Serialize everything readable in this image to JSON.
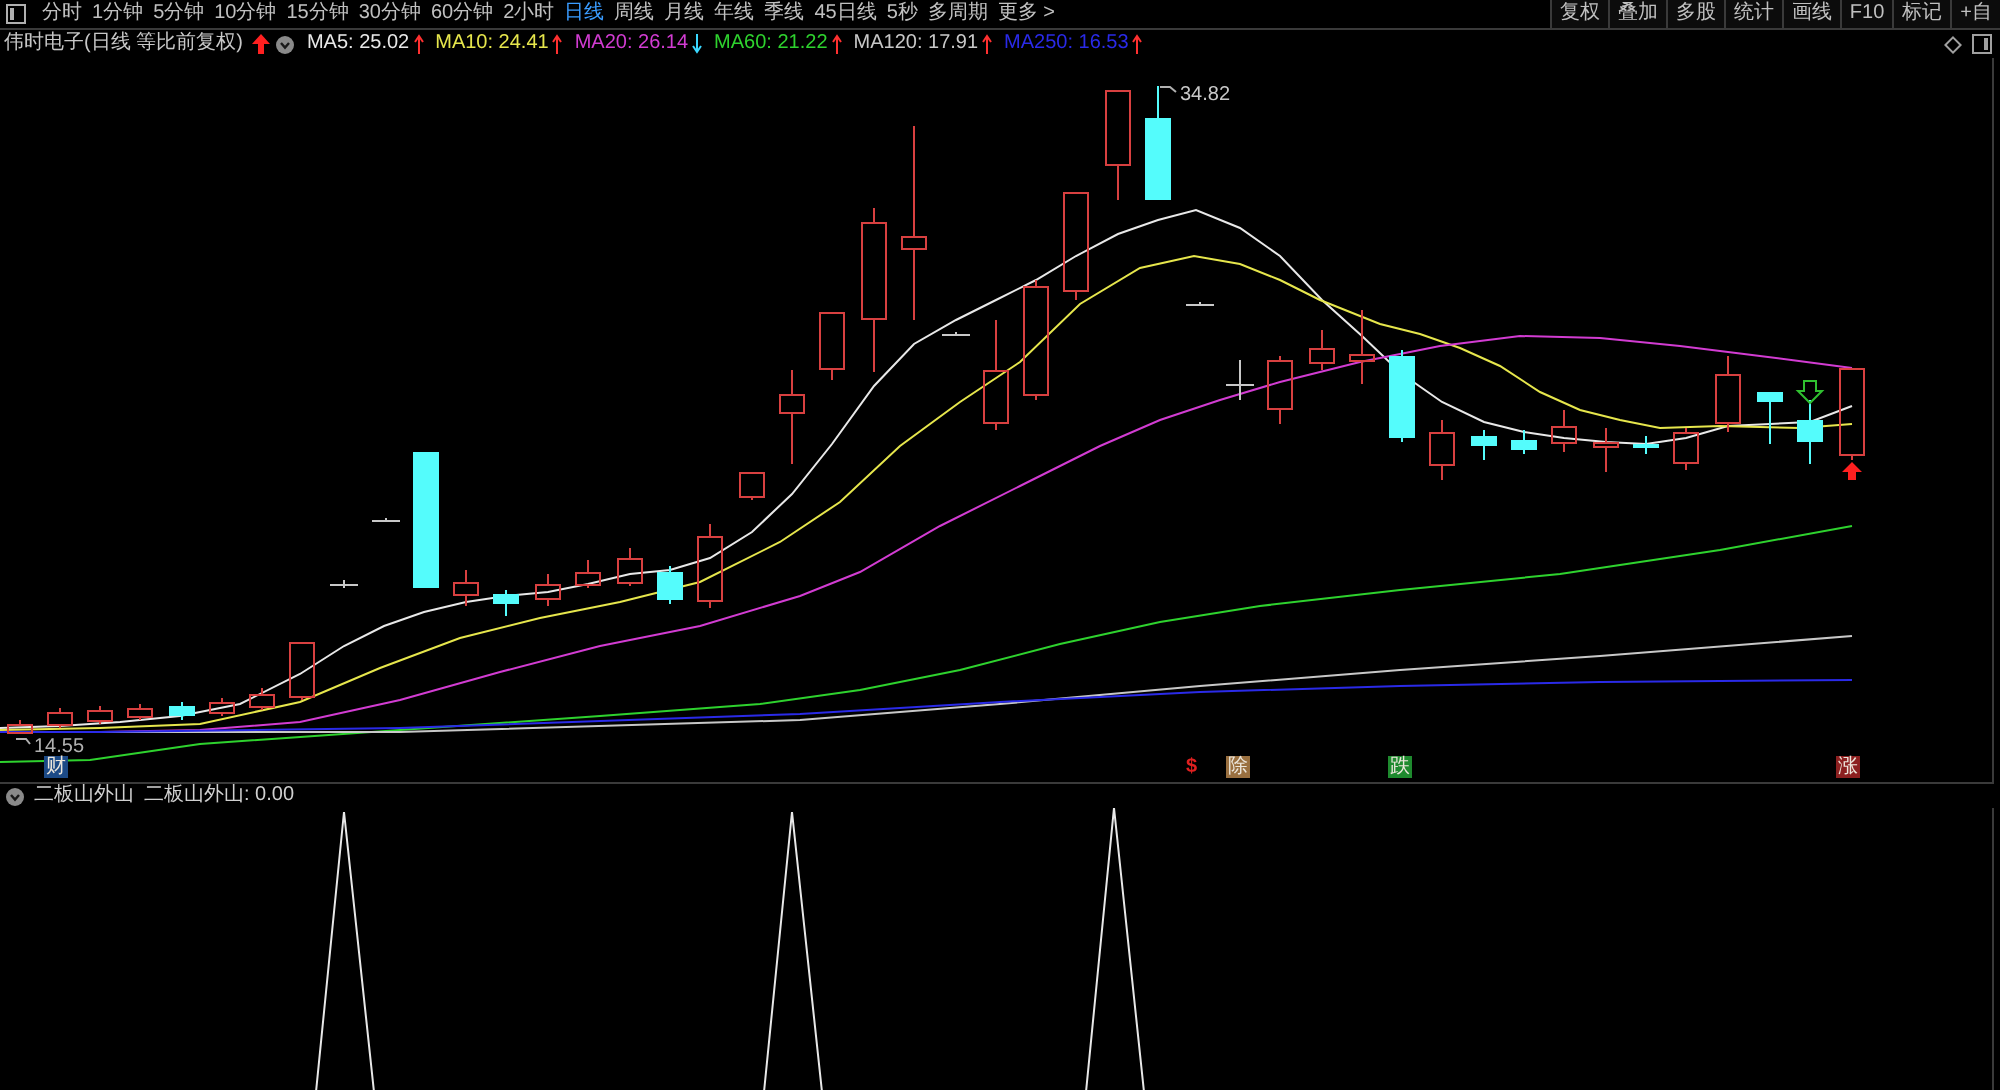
{
  "toolbar": {
    "periods": [
      {
        "label": "分时",
        "selected": false
      },
      {
        "label": "1分钟",
        "selected": false
      },
      {
        "label": "5分钟",
        "selected": false
      },
      {
        "label": "10分钟",
        "selected": false
      },
      {
        "label": "15分钟",
        "selected": false
      },
      {
        "label": "30分钟",
        "selected": false
      },
      {
        "label": "60分钟",
        "selected": false
      },
      {
        "label": "2小时",
        "selected": false
      },
      {
        "label": "日线",
        "selected": true
      },
      {
        "label": "周线",
        "selected": false
      },
      {
        "label": "月线",
        "selected": false
      },
      {
        "label": "年线",
        "selected": false
      },
      {
        "label": "季线",
        "selected": false
      },
      {
        "label": "45日线",
        "selected": false
      },
      {
        "label": "5秒",
        "selected": false
      },
      {
        "label": "多周期",
        "selected": false
      },
      {
        "label": "更多 >",
        "selected": false
      }
    ],
    "tools": [
      "复权",
      "叠加",
      "多股",
      "统计",
      "画线",
      "F10",
      "标记",
      "+自"
    ]
  },
  "chart_header": {
    "title": "伟时电子(日线 等比前复权)",
    "moving_averages": [
      {
        "label": "MA5: 25.02",
        "color": "#e8e8e8",
        "rising": true
      },
      {
        "label": "MA10: 24.41",
        "color": "#e6e64c",
        "rising": true
      },
      {
        "label": "MA20: 26.14",
        "color": "#d23cd2",
        "rising": false
      },
      {
        "label": "MA60: 21.22",
        "color": "#2ed22e",
        "rising": true
      },
      {
        "label": "MA120: 17.91",
        "color": "#c8c8c8",
        "rising": true
      },
      {
        "label": "MA250: 16.53",
        "color": "#2a2ae8",
        "rising": true
      }
    ]
  },
  "price_chart": {
    "high_label": "34.82",
    "low_label": "14.55",
    "markers": [
      {
        "label": "财",
        "kind": "badge",
        "color": "#1c4a86"
      },
      {
        "label": "$",
        "kind": "text",
        "color": "#e02020"
      },
      {
        "label": "除",
        "kind": "badge",
        "color": "#9a7040"
      },
      {
        "label": "跌",
        "kind": "badge",
        "color": "#1e8a2e"
      },
      {
        "label": "涨",
        "kind": "badge",
        "color": "#8c2020"
      }
    ]
  },
  "indicator": {
    "name": "二板山外山",
    "reading": "二板山外山: 0.00"
  }
}
